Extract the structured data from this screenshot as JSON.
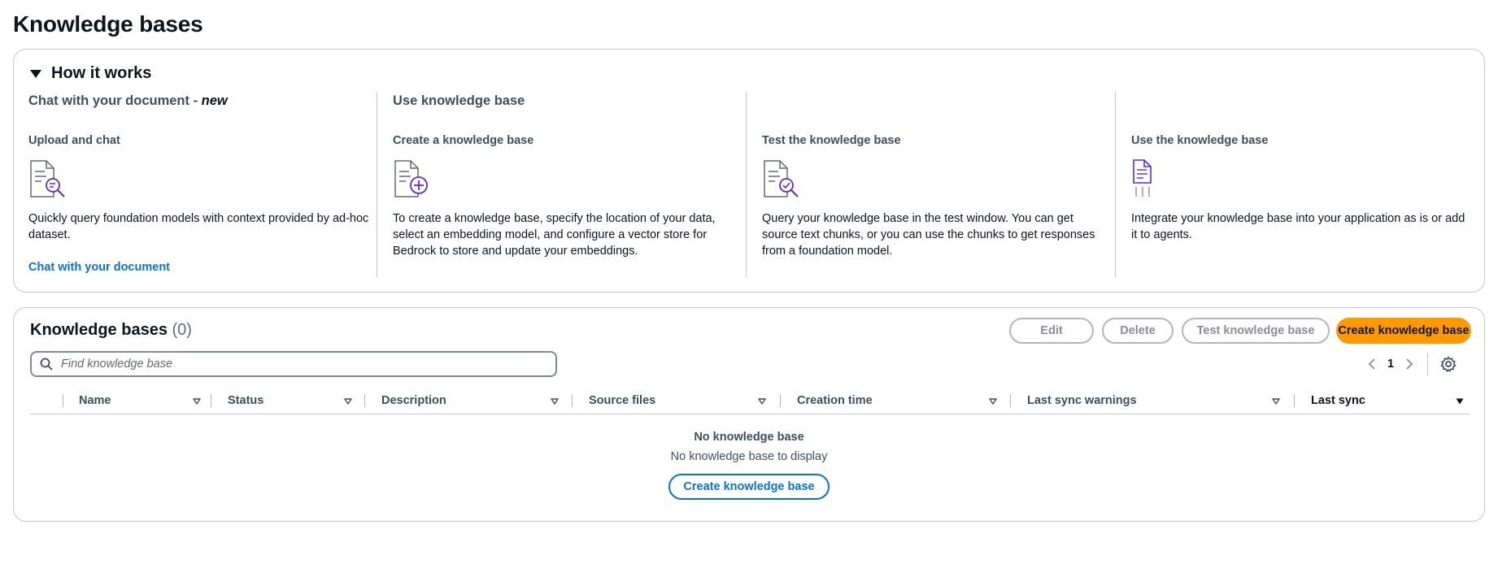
{
  "page": {
    "title": "Knowledge bases"
  },
  "how_it_works": {
    "title": "How it works",
    "chat_section": {
      "title": "Chat with your document - ",
      "title_new": "new",
      "step_title": "Upload and chat",
      "description": "Quickly query foundation models with context provided by ad-hoc dataset.",
      "link": "Chat with your document"
    },
    "kb_section": {
      "title": "Use knowledge base",
      "steps": [
        {
          "title": "Create a knowledge base",
          "description": "To create a knowledge base, specify the location of your data, select an embedding model, and configure a vector store for Bedrock to store and update your embeddings.",
          "icon": "document-add-icon"
        },
        {
          "title": "Test the knowledge base",
          "description": "Query your knowledge base in the test window. You can get source text chunks, or you can use the chunks to get responses from a foundation model.",
          "icon": "document-check-icon"
        },
        {
          "title": "Use the knowledge base",
          "description": "Integrate your knowledge base into your application as is or add it to agents.",
          "icon": "document-integrate-icon"
        }
      ]
    }
  },
  "kb_table": {
    "title": "Knowledge bases",
    "count": "(0)",
    "buttons": {
      "edit": "Edit",
      "delete": "Delete",
      "test": "Test knowledge base",
      "create": "Create knowledge base"
    },
    "search": {
      "placeholder": "Find knowledge base",
      "value": ""
    },
    "pagination": {
      "current_page": "1"
    },
    "columns": [
      "Name",
      "Status",
      "Description",
      "Source files",
      "Creation time",
      "Last sync warnings",
      "Last sync"
    ],
    "empty": {
      "title": "No knowledge base",
      "description": "No knowledge base to display",
      "action": "Create knowledge base"
    }
  },
  "colors": {
    "accent": "#0972d3",
    "primary_button": "#ff9900",
    "icon": "#5a2bd6",
    "border": "#c6c6cd",
    "text_muted": "#414d5c"
  }
}
